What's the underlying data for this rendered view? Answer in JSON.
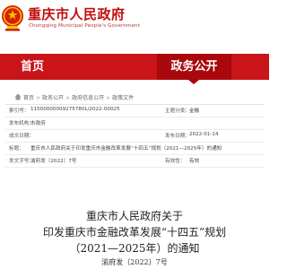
{
  "header": {
    "title": "重庆市人民政府",
    "subtitle": "Chongqing Municipal People's Government"
  },
  "nav": {
    "home": "首页",
    "active": "政务公开"
  },
  "breadcrumb": {
    "items": [
      "首页",
      "政务公开",
      "政府信息公开",
      "政策文件"
    ]
  },
  "info": {
    "rows": [
      {
        "label": "索引号：",
        "value": "11500000009275780L/2022-00025",
        "label2": "主题分类：",
        "value2": "金融"
      },
      {
        "label": "发布机构：",
        "value": "市政府",
        "label2": "",
        "value2": ""
      },
      {
        "label": "成文日期：",
        "value": "",
        "label2": "发布日期：",
        "value2": "2022-01-14"
      },
      {
        "label": "标题：",
        "value": "重庆市人民政府关于印发重庆市金融改革发展“十四五”规划（2021—2025年）的通知",
        "label2": "",
        "value2": ""
      },
      {
        "label": "发文字号：",
        "value": "渝府发〔2022〕7号",
        "label2": "有效性：",
        "value2": "有效"
      }
    ]
  },
  "document": {
    "issuer": "重庆市人民政府关于",
    "title_line1": "印发重庆市金融改革发展“十四五”规划",
    "title_line2": "（2021—2025年）的通知",
    "number": "渝府发〔2022〕7号"
  },
  "colors": {
    "brand_red": "#c9141a",
    "nav_active": "#a9080d",
    "title_red": "#c20e0e"
  }
}
